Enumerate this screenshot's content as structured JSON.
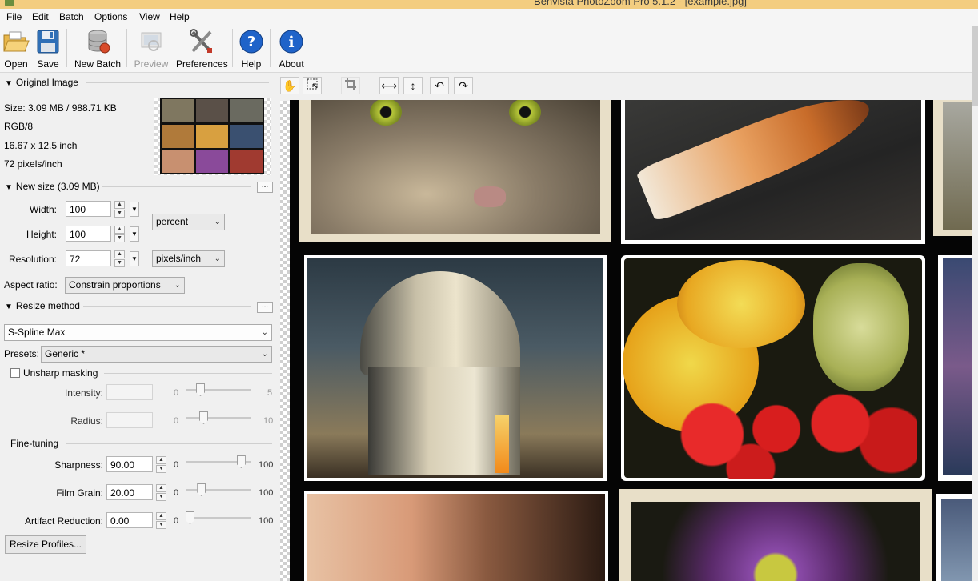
{
  "window": {
    "title": "Benvista PhotoZoom Pro 5.1.2 - [example.jpg]"
  },
  "menu": [
    "File",
    "Edit",
    "Batch",
    "Options",
    "View",
    "Help"
  ],
  "toolbar": {
    "open": "Open",
    "save": "Save",
    "new_batch": "New Batch",
    "preview": "Preview",
    "preferences": "Preferences",
    "help": "Help",
    "about": "About"
  },
  "original_image": {
    "header": "Original Image",
    "size": "Size: 3.09 MB / 988.71 KB",
    "mode": "RGB/8",
    "dimensions": "16.67 x 12.5 inch",
    "resolution": "72 pixels/inch"
  },
  "new_size": {
    "header": "New size (3.09 MB)",
    "more_label": "...",
    "width_label": "Width:",
    "width_value": "100",
    "height_label": "Height:",
    "height_value": "100",
    "resolution_label": "Resolution:",
    "resolution_value": "72",
    "unit": "percent",
    "res_unit": "pixels/inch",
    "aspect_label": "Aspect ratio:",
    "aspect_value": "Constrain proportions"
  },
  "resize_method": {
    "header": "Resize method",
    "more_label": "...",
    "method": "S-Spline Max",
    "presets_label": "Presets:",
    "preset_value": "Generic *",
    "unsharp_label": "Unsharp masking",
    "intensity_label": "Intensity:",
    "intensity_min": "0",
    "intensity_max": "5",
    "radius_label": "Radius:",
    "radius_min": "0",
    "radius_max": "10"
  },
  "fine_tuning": {
    "header": "Fine-tuning",
    "sharpness_label": "Sharpness:",
    "sharpness_value": "90.00",
    "sharpness_min": "0",
    "sharpness_max": "100",
    "sharpness_level": 0.9,
    "film_grain_label": "Film Grain:",
    "film_grain_value": "20.00",
    "film_grain_min": "0",
    "film_grain_max": "100",
    "film_grain_level": 0.2,
    "artifact_label": "Artifact Reduction:",
    "artifact_value": "0.00",
    "artifact_min": "0",
    "artifact_max": "100",
    "artifact_level": 0.0
  },
  "resize_profiles_button": "Resize Profiles...",
  "icons": {
    "open": "folder-open-icon",
    "save": "floppy-disk-icon",
    "new_batch": "database-icon",
    "preview": "preview-icon",
    "preferences": "tools-icon",
    "help": "question-icon",
    "about": "info-icon",
    "pan": "hand-icon",
    "select": "selection-icon",
    "crop": "crop-icon",
    "fit_width": "fit-width-icon",
    "fit_height": "fit-height-icon",
    "rotate_left": "rotate-left-icon",
    "rotate_right": "rotate-right-icon"
  },
  "colors": {
    "titlebar": "#f3cd80",
    "accent": "#1f63c9",
    "canvas": "#050505"
  }
}
